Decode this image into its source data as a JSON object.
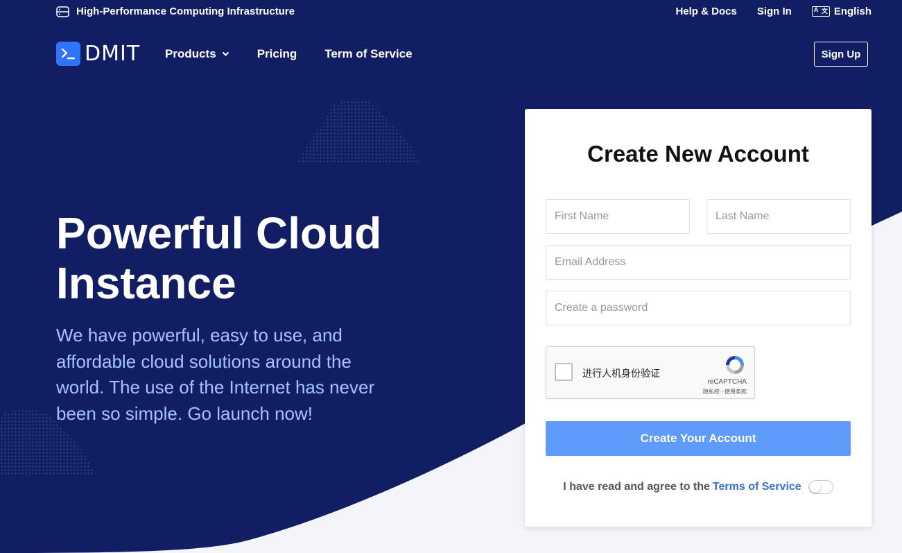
{
  "topbar": {
    "tagline": "High-Performance Computing Infrastructure",
    "links": {
      "help": "Help & Docs",
      "signin": "Sign In"
    },
    "language": "English",
    "language_icon": "translate-icon"
  },
  "nav": {
    "logo_text": "DMIT",
    "logo_icon": "terminal-icon",
    "items": {
      "products": "Products",
      "pricing": "Pricing",
      "terms": "Term of Service"
    },
    "signup_label": "Sign Up"
  },
  "hero": {
    "title_line1": "Powerful Cloud",
    "title_line2": "Instance",
    "description_line1": "We have powerful, easy to use, and",
    "description_line2": "affordable cloud solutions around the",
    "description_line3": "world. The use of the Internet has never",
    "description_line4": "been so simple. Go launch now!"
  },
  "form": {
    "title": "Create New Account",
    "first_name_placeholder": "First Name",
    "last_name_placeholder": "Last Name",
    "email_placeholder": "Email Address",
    "password_placeholder": "Create a password",
    "recaptcha": {
      "label": "进行人机身份验证",
      "brand": "reCAPTCHA",
      "links": "隐私权 - 使用条款"
    },
    "submit_label": "Create Your Account",
    "agree_prefix": "I have read and agree to the",
    "agree_link": "Terms of Service",
    "agree_checked": false
  },
  "colors": {
    "hero_bg": "#121e63",
    "light_bg": "#f4f5fa",
    "accent": "#2f73ff",
    "button": "#5e9bfa",
    "hero_text": "#a7c3ff",
    "link": "#3a6fc4"
  }
}
